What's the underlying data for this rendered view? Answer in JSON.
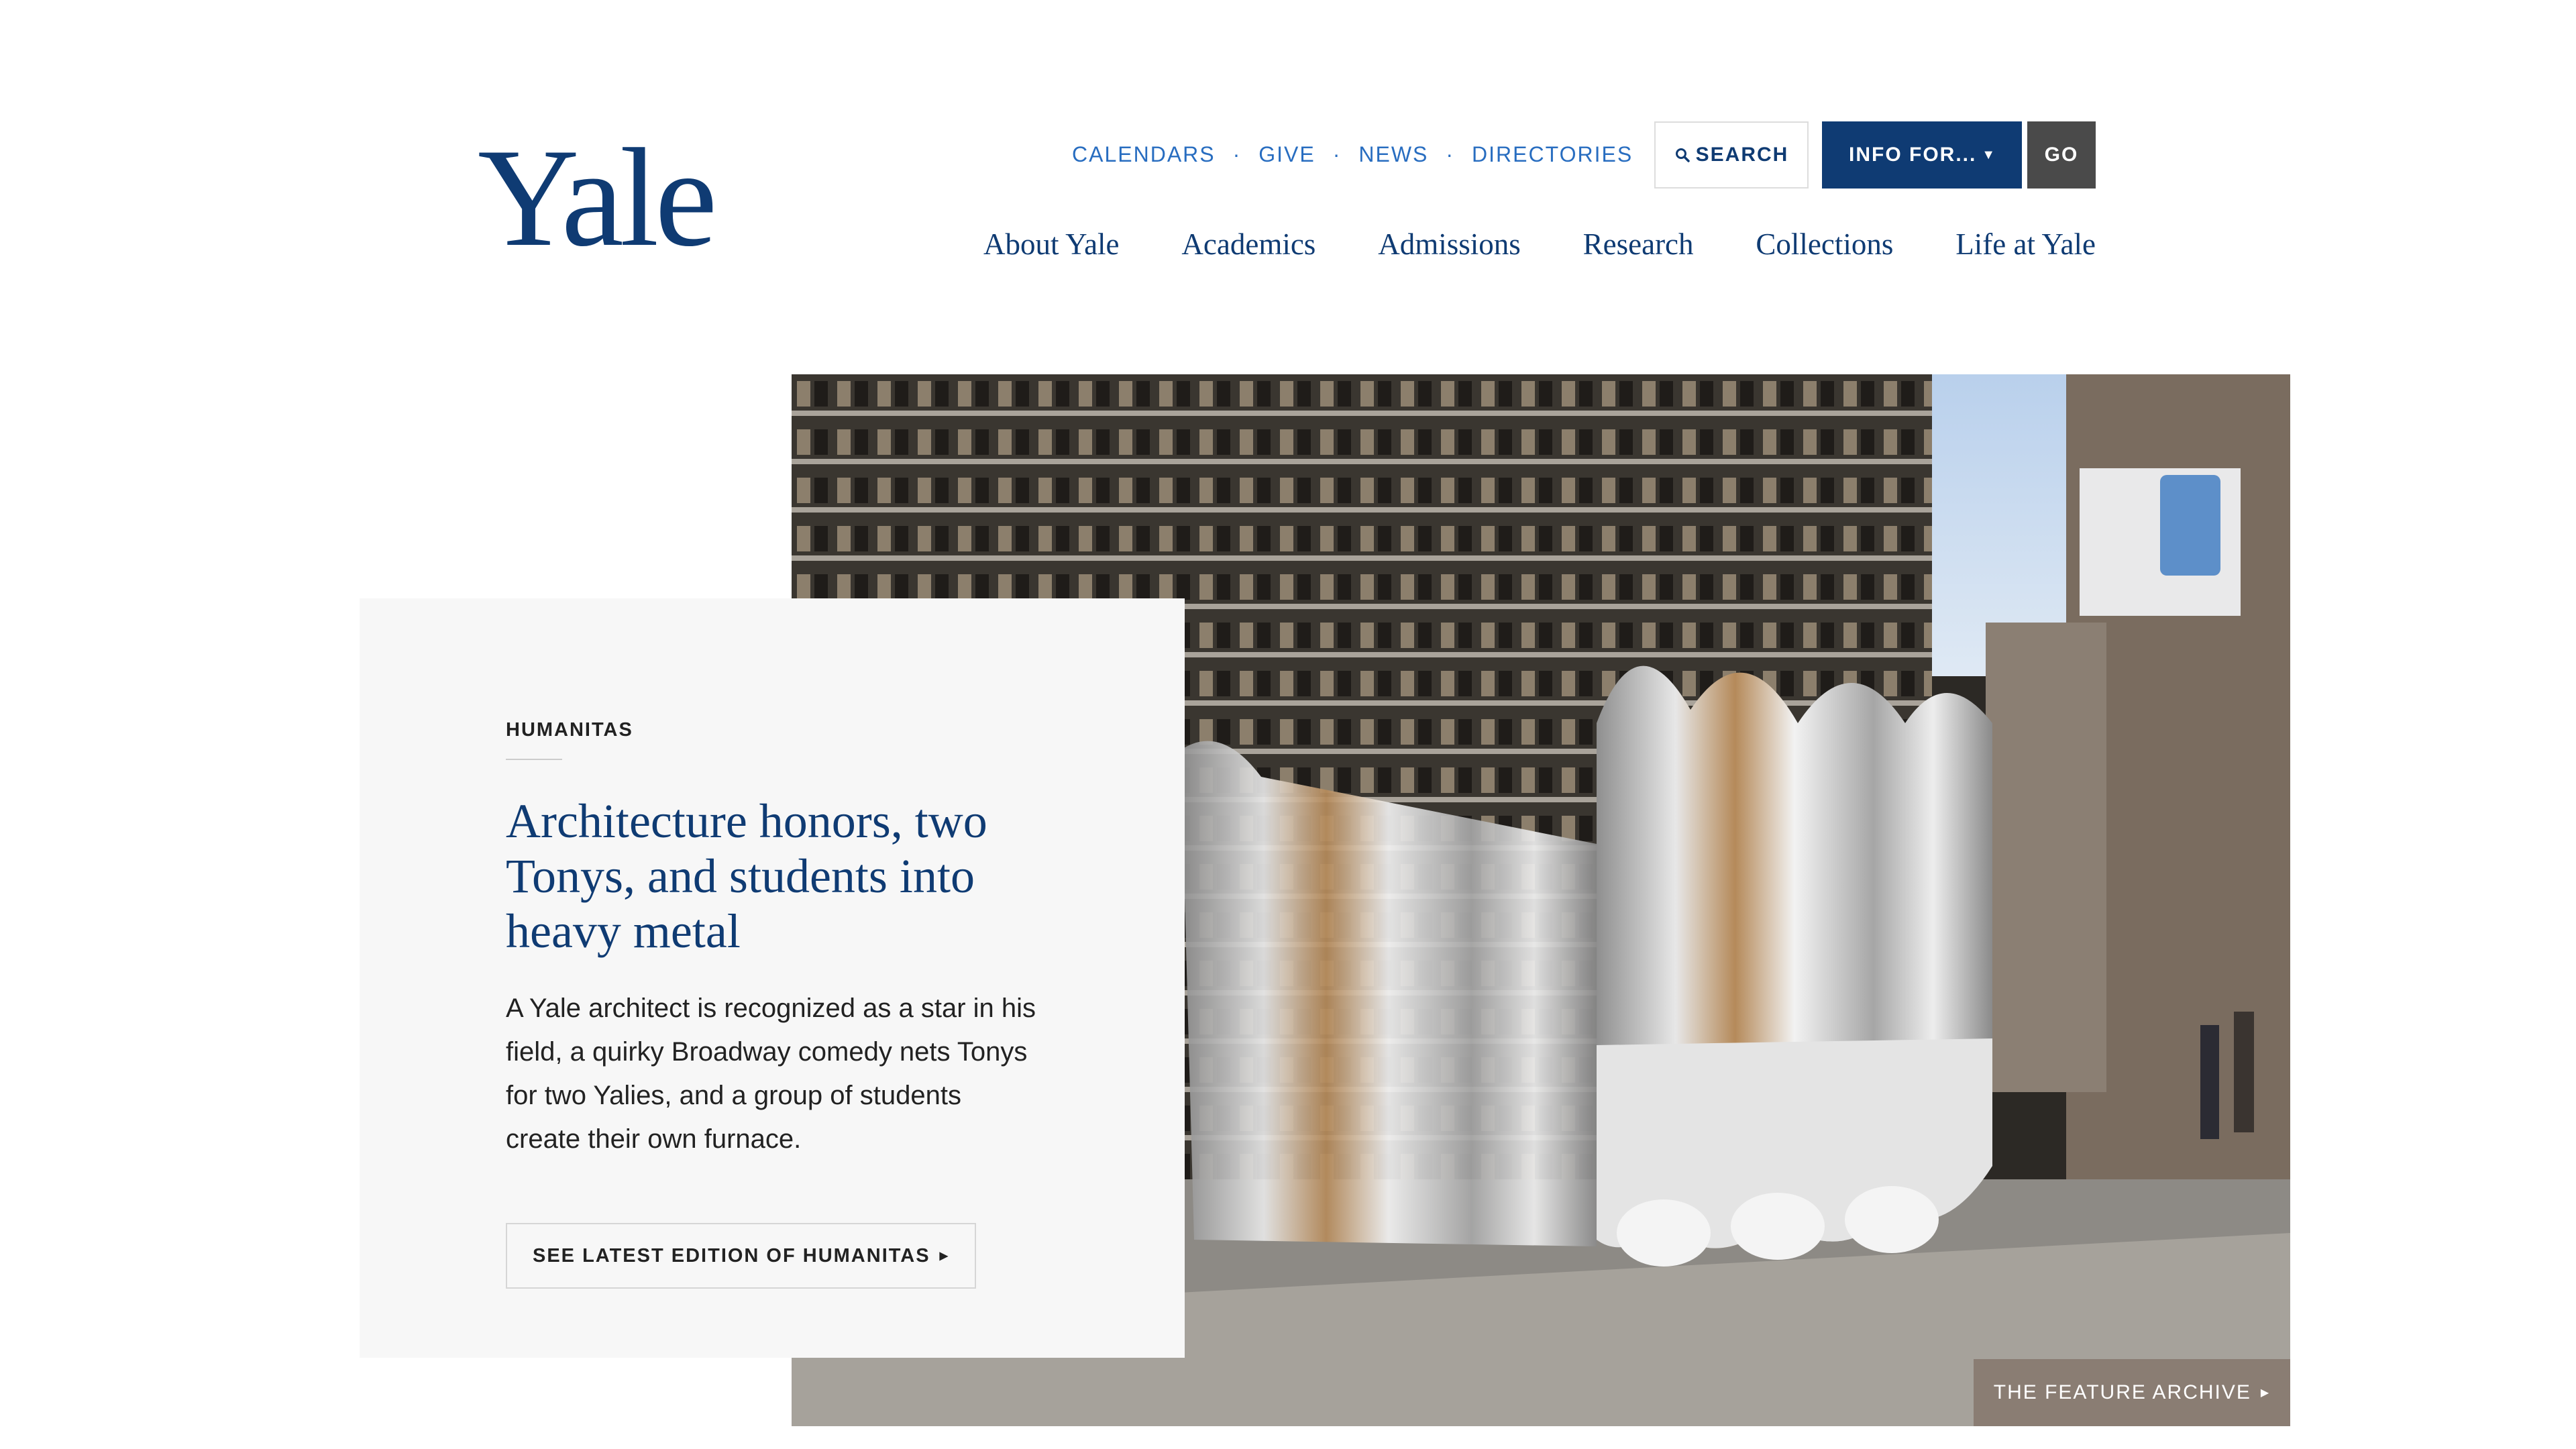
{
  "logo": "Yale",
  "utility": [
    "CALENDARS",
    "GIVE",
    "NEWS",
    "DIRECTORIES"
  ],
  "utility_separator": "·",
  "search": {
    "label": "SEARCH",
    "icon": "search-icon"
  },
  "info_for": {
    "label": "INFO FOR...",
    "caret": "▼"
  },
  "go": "GO",
  "main_nav": [
    "About Yale",
    "Academics",
    "Admissions",
    "Research",
    "Collections",
    "Life at Yale"
  ],
  "feature": {
    "kicker": "HUMANITAS",
    "headline": "Architecture honors, two Tonys, and students into heavy metal",
    "summary": "A Yale architect is recognized as a star in his field, a quirky Broadway comedy nets Tonys for two Yalies, and a group of students create their own furnace.",
    "button": "SEE LATEST EDITION OF HUMANITAS",
    "button_arrow": "▶"
  },
  "archive_button": "THE FEATURE ARCHIVE",
  "archive_arrow": "▶",
  "colors": {
    "brand": "#0f3b73",
    "link": "#286dc0",
    "card_bg": "#f7f7f7",
    "archive_bg": "#8a7d73",
    "go_bg": "#4a4a4a"
  }
}
